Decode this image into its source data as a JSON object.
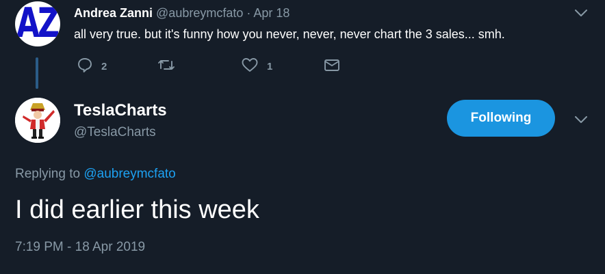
{
  "parent_tweet": {
    "avatar_text": "AZ",
    "name": "Andrea Zanni",
    "handle": "@aubreymcfato",
    "separator": " · ",
    "date": "Apr 18",
    "text": "all very true. but it's funny how you never, never, never chart the 3 sales... smh.",
    "replies_count": "2",
    "retweets_count": "",
    "likes_count": "1",
    "icons": {
      "reply": "reply-icon",
      "retweet": "retweet-icon",
      "like": "heart-icon",
      "dm": "envelope-icon",
      "menu": "chevron-down-icon"
    }
  },
  "main_tweet": {
    "name": "TeslaCharts",
    "handle": "@TeslaCharts",
    "follow_button_label": "Following",
    "replying_prefix": "Replying to ",
    "replying_to": "@aubreymcfato",
    "text": "I did earlier this week",
    "timestamp": "7:19 PM - 18 Apr 2019"
  },
  "colors": {
    "background": "#151d28",
    "secondary_text": "#8899a6",
    "accent": "#1da1f2",
    "follow_button": "#1b95e0",
    "thread_line": "#2b5c88"
  }
}
